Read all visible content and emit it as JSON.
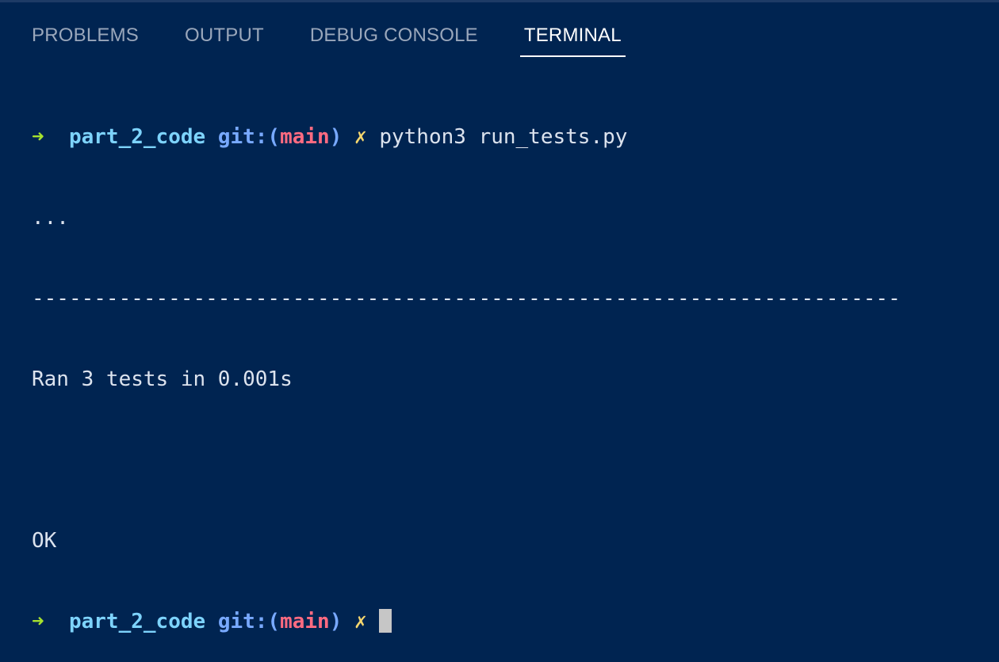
{
  "panel": {
    "tabs": [
      {
        "label": "PROBLEMS",
        "active": false
      },
      {
        "label": "OUTPUT",
        "active": false
      },
      {
        "label": "DEBUG CONSOLE",
        "active": false
      },
      {
        "label": "TERMINAL",
        "active": true
      }
    ]
  },
  "terminal": {
    "prompt_arrow": "➜",
    "directory": "part_2_code",
    "git_prefix": "git:(",
    "branch": "main",
    "git_suffix": ")",
    "dirty_marker": "✗",
    "command": "python3 run_tests.py",
    "dots_line": "...",
    "separator": "----------------------------------------------------------------------",
    "result_line": "Ran 3 tests in 0.001s",
    "status": "OK"
  },
  "colors": {
    "background": "#002451",
    "arrow": "#a6e22e",
    "directory": "#7dd3fc",
    "git": "#78a9ff",
    "branch": "#ff6b81",
    "dirty": "#f5d76e"
  }
}
